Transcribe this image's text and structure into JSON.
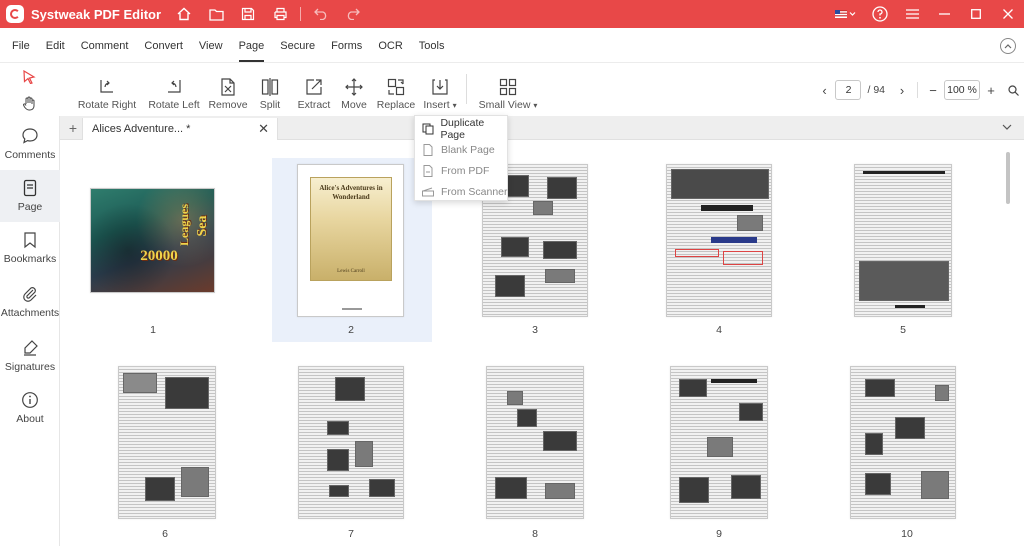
{
  "app": {
    "title": "Systweak PDF Editor",
    "accent": "#e84848"
  },
  "titlebar": {
    "icons": [
      "home-icon",
      "folder-icon",
      "save-icon",
      "print-icon",
      "undo-icon",
      "redo-icon"
    ],
    "right_icons": [
      "flag-us-icon",
      "help-icon",
      "menu-icon",
      "minimize-icon",
      "maximize-icon",
      "close-icon"
    ]
  },
  "menu": [
    "File",
    "Edit",
    "Comment",
    "Convert",
    "View",
    "Page",
    "Secure",
    "Forms",
    "OCR",
    "Tools"
  ],
  "active_menu": "Page",
  "toolbar": {
    "rotate_right": "Rotate Right",
    "rotate_left": "Rotate Left",
    "remove": "Remove",
    "split": "Split",
    "extract": "Extract",
    "move": "Move",
    "replace": "Replace",
    "insert": "Insert",
    "small_view": "Small View"
  },
  "pager": {
    "current_page": "2",
    "total": "/ 94",
    "zoom": "100 %"
  },
  "sidebar": {
    "items": [
      "Comments",
      "Page",
      "Bookmarks",
      "Attachments",
      "Signatures",
      "About"
    ],
    "active": "Page"
  },
  "tab": {
    "title": "Alices Adventure... *"
  },
  "insert_menu": [
    "Duplicate Page",
    "Blank Page",
    "From PDF",
    "From Scanner"
  ],
  "pages": [
    {
      "num": "1"
    },
    {
      "num": "2"
    },
    {
      "num": "3"
    },
    {
      "num": "4"
    },
    {
      "num": "5"
    },
    {
      "num": "6"
    },
    {
      "num": "7"
    },
    {
      "num": "8"
    },
    {
      "num": "9"
    },
    {
      "num": "10"
    }
  ],
  "cover1": {
    "line1": "20000",
    "line2": "Leagues",
    "line3": "Sea"
  },
  "cover2": {
    "title": "Alice's Adventures in Wonderland",
    "author": "Lewis Carroll"
  }
}
